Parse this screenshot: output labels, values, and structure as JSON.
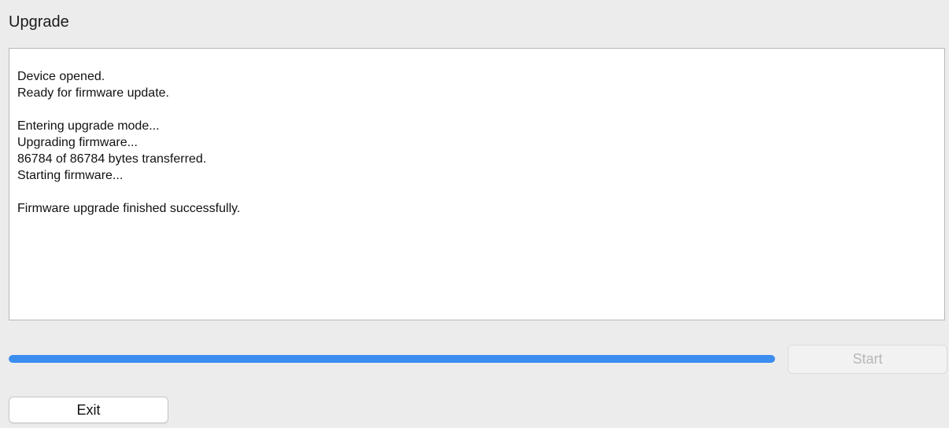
{
  "window": {
    "title": "Upgrade"
  },
  "log": {
    "lines": [
      "Device opened.",
      "Ready for firmware update.",
      "",
      "Entering upgrade mode...",
      "Upgrading firmware...",
      "86784 of 86784 bytes transferred.",
      "Starting firmware...",
      "",
      "Firmware upgrade finished successfully."
    ]
  },
  "progress": {
    "value": 1.0,
    "color": "#3b8ef0"
  },
  "buttons": {
    "start_label": "Start",
    "start_enabled": false,
    "exit_label": "Exit"
  }
}
